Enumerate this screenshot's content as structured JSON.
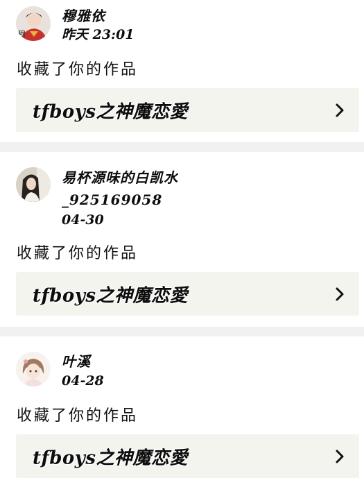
{
  "colors": {
    "background": "#ffffff",
    "divider": "#f1f1f1",
    "work_card": "#f4f4ef",
    "text": "#111111"
  },
  "notifications": [
    {
      "user_name": "穆雅依",
      "time": "昨天 23:01",
      "action": "收藏了你的作品",
      "work_title": "tfboys之神魔恋愛",
      "avatar": "avatar-red-costume",
      "chevron_icon": "chevron-right-icon"
    },
    {
      "user_name_line1": "易杯源味的白凯水",
      "user_name_line2": "_925169058",
      "time": "04-30",
      "action": "收藏了你的作品",
      "work_title": "tfboys之神魔恋愛",
      "avatar": "avatar-dark-hair",
      "chevron_icon": "chevron-right-icon"
    },
    {
      "user_name": "叶溪",
      "time": "04-28",
      "action": "收藏了你的作品",
      "work_title": "tfboys之神魔恋愛",
      "avatar": "avatar-anime-girl",
      "chevron_icon": "chevron-right-icon"
    }
  ]
}
